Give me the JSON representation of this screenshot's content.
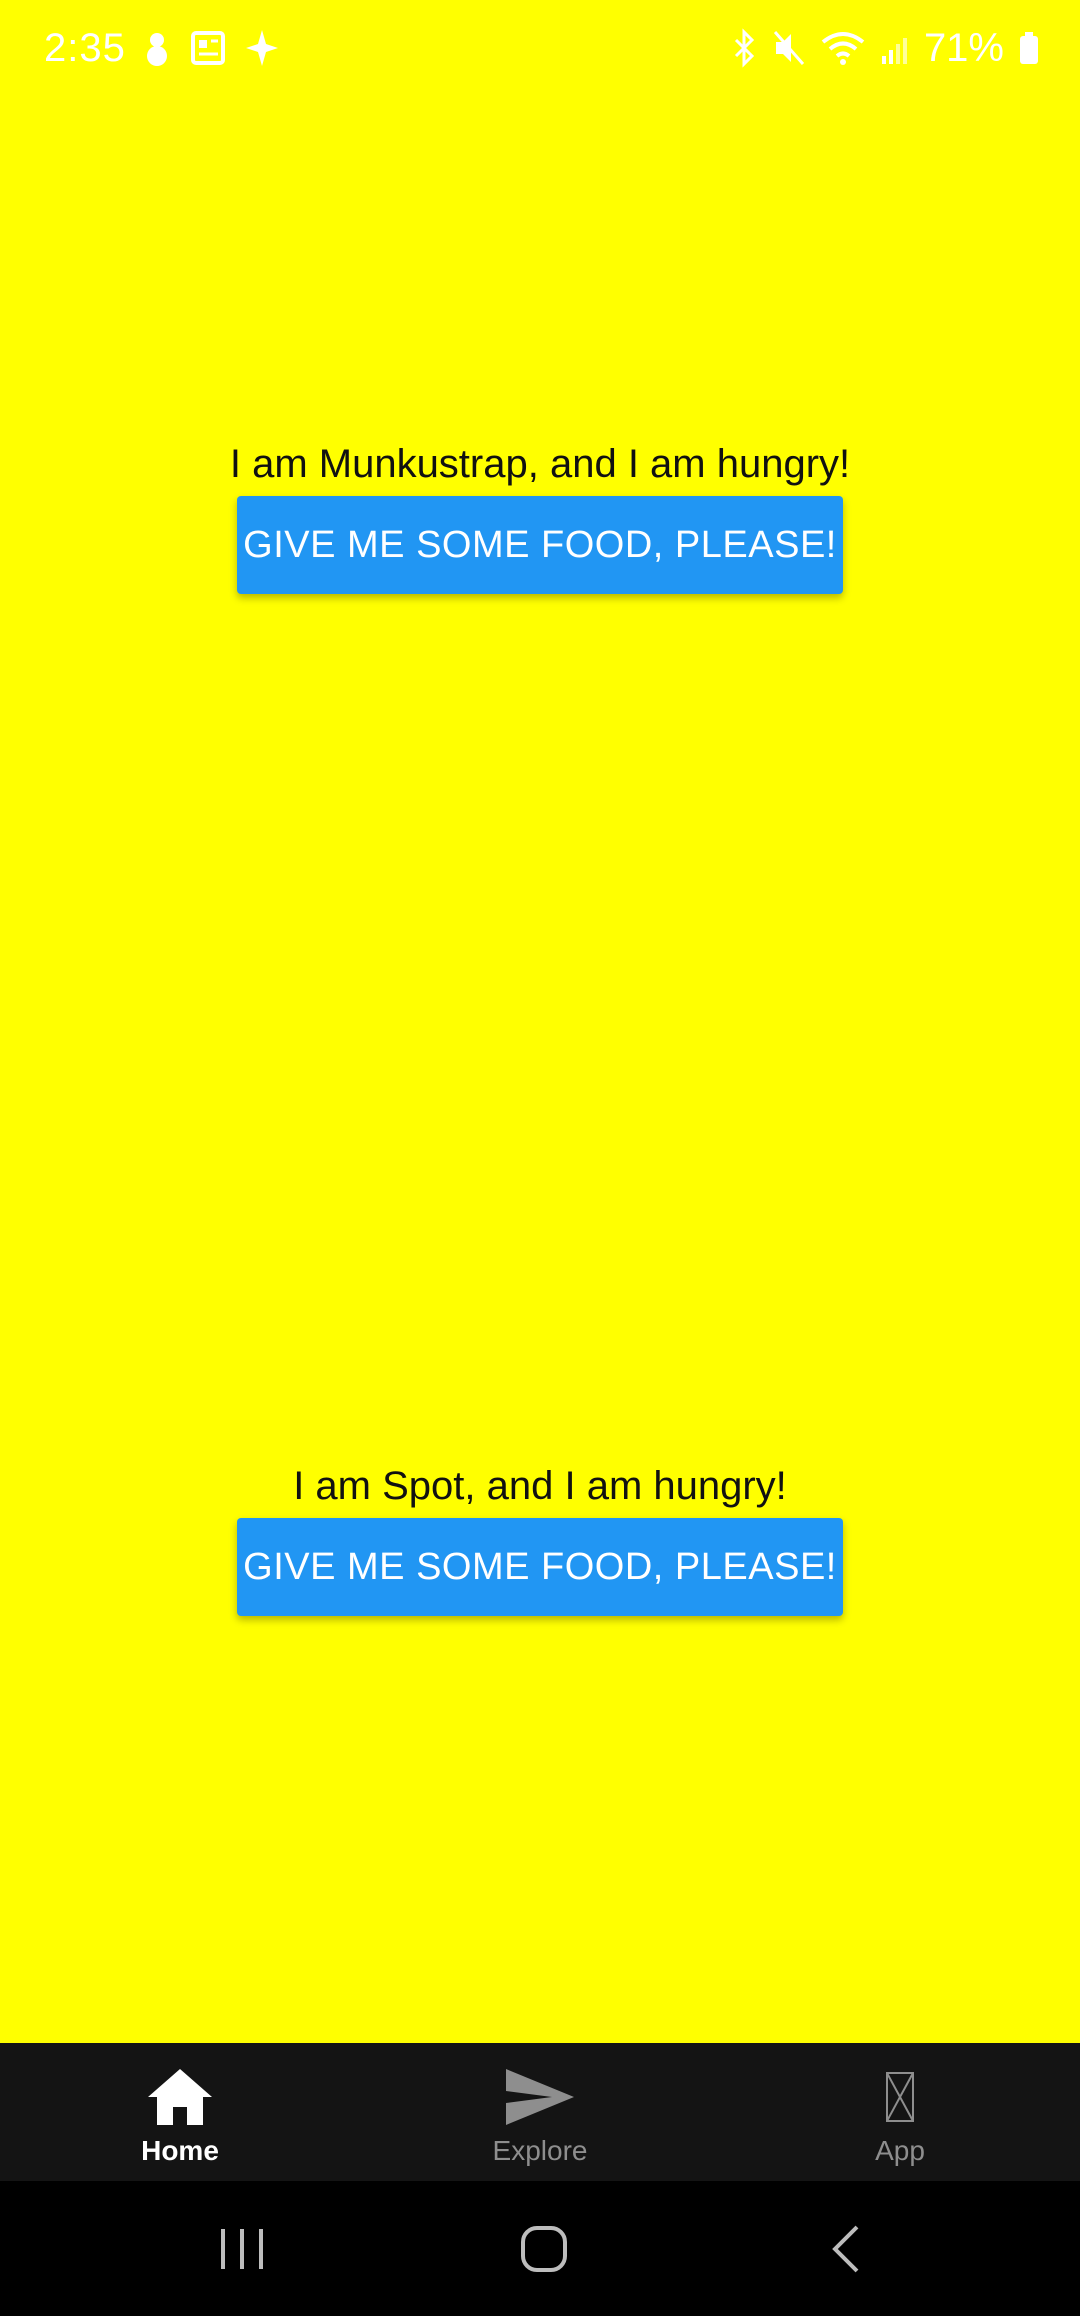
{
  "status_bar": {
    "time": "2:35",
    "battery": "71%",
    "left_icons": [
      "snowman-icon",
      "news-icon",
      "sparkle-icon"
    ],
    "right_icons": [
      "bluetooth-icon",
      "mute-icon",
      "wifi-icon",
      "signal-icon",
      "battery-icon"
    ]
  },
  "cats": [
    {
      "message": "I am Munkustrap, and I am hungry!",
      "button_label": "GIVE ME SOME FOOD, PLEASE!"
    },
    {
      "message": "I am Spot, and I am hungry!",
      "button_label": "GIVE ME SOME FOOD, PLEASE!"
    }
  ],
  "tabs": [
    {
      "label": "Home",
      "icon": "home-icon",
      "active": true
    },
    {
      "label": "Explore",
      "icon": "send-icon",
      "active": false
    },
    {
      "label": "App",
      "icon": "missing-glyph-icon",
      "active": false
    }
  ],
  "nav": [
    "recent-apps-icon",
    "home-circle-icon",
    "back-icon"
  ],
  "colors": {
    "background": "#FFFF00",
    "button": "#2196F3",
    "tab_bar": "#141414",
    "nav_bar": "#000000"
  }
}
